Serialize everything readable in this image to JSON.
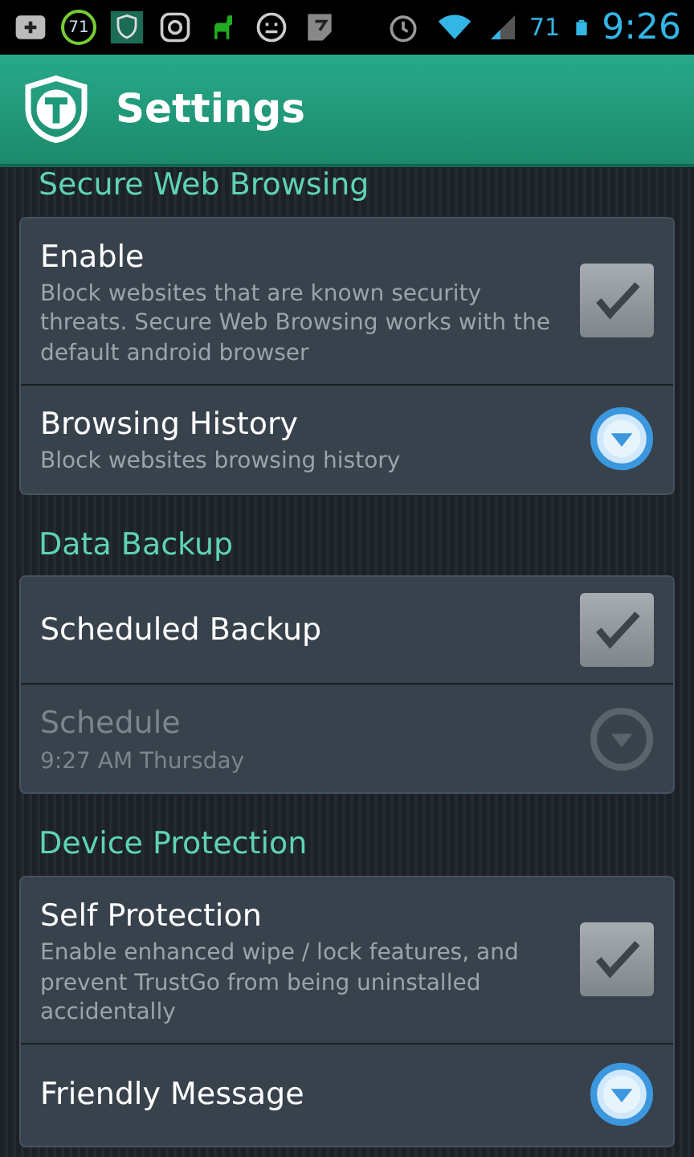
{
  "status_bar": {
    "notification_badge": "71",
    "battery_level_text": "71",
    "time": "9:26"
  },
  "app_bar": {
    "title": "Settings"
  },
  "sections": [
    {
      "title": "Secure Web Browsing",
      "items": [
        {
          "kind": "checkbox",
          "title": "Enable",
          "summary": "Block websites that are known security threats. Secure Web Browsing works with the default android browser",
          "checked": true,
          "disabled": false
        },
        {
          "kind": "dropdown",
          "title": "Browsing History",
          "summary": "Block websites browsing history",
          "disabled": false
        }
      ]
    },
    {
      "title": "Data Backup",
      "items": [
        {
          "kind": "checkbox",
          "title": "Scheduled Backup",
          "checked": true,
          "disabled": false
        },
        {
          "kind": "dropdown",
          "title": "Schedule",
          "summary": "9:27 AM Thursday",
          "disabled": true
        }
      ]
    },
    {
      "title": "Device Protection",
      "items": [
        {
          "kind": "checkbox",
          "title": "Self Protection",
          "summary": "Enable enhanced wipe / lock features, and prevent TrustGo from being uninstalled accidentally",
          "checked": true,
          "disabled": false
        },
        {
          "kind": "dropdown",
          "title": "Friendly Message",
          "disabled": false
        }
      ]
    }
  ]
}
